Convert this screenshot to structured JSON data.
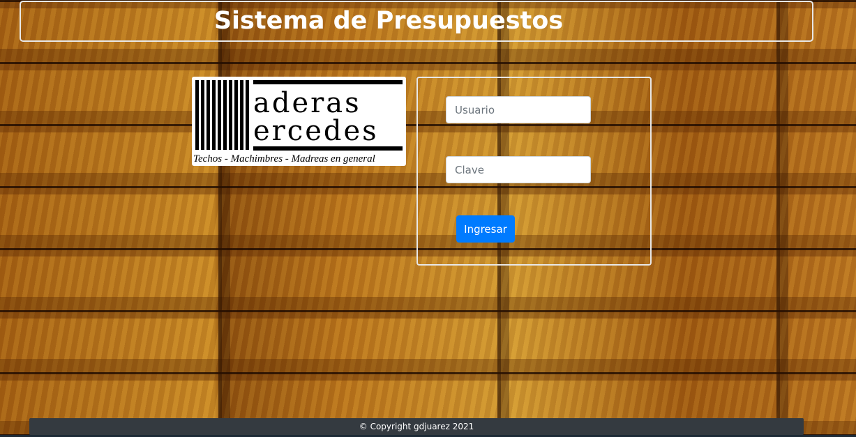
{
  "header": {
    "title": "Sistema de Presupuestos"
  },
  "logo": {
    "line1": "aderas",
    "line2": "ercedes",
    "tagline": "Techos - Machimbres - Madreas en general",
    "brand": "Maderas Mercedes"
  },
  "login": {
    "user_placeholder": "Usuario",
    "password_placeholder": "Clave",
    "submit_label": "Ingresar"
  },
  "footer": {
    "text": "© Copyright gdjuarez 2021"
  },
  "colors": {
    "button": "#007bff",
    "footer": "#343a40"
  }
}
